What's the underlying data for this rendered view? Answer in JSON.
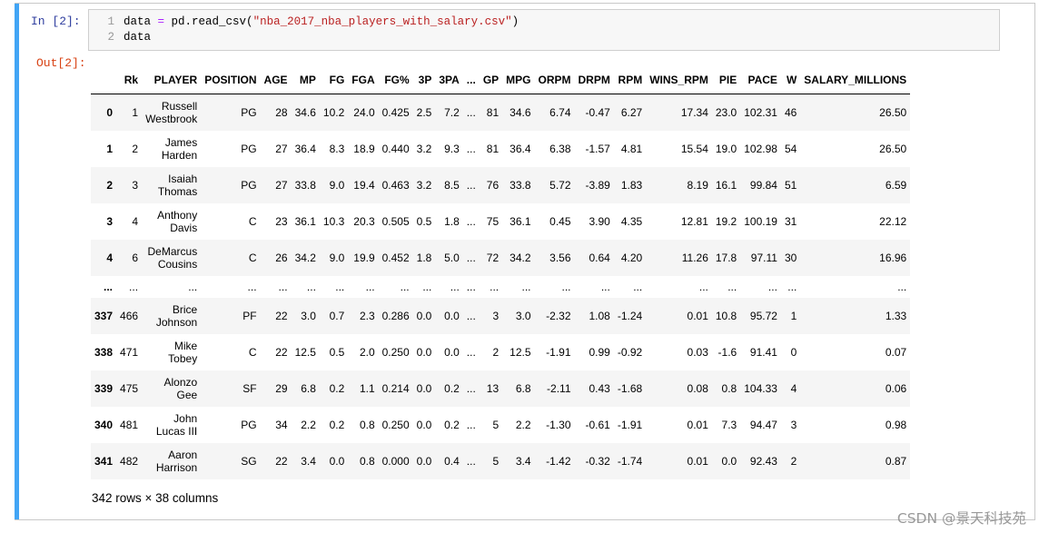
{
  "cell": {
    "in_prompt": "In  [2]:",
    "out_prompt": "Out[2]:",
    "line_numbers": [
      "1",
      "2"
    ],
    "code": {
      "line1_pre": "data ",
      "line1_op": "=",
      "line1_mid": " pd.read_csv(",
      "line1_str": "\"nba_2017_nba_players_with_salary.csv\"",
      "line1_post": ")",
      "line2": "data"
    }
  },
  "table": {
    "columns": [
      "",
      "Rk",
      "PLAYER",
      "POSITION",
      "AGE",
      "MP",
      "FG",
      "FGA",
      "FG%",
      "3P",
      "3PA",
      "...",
      "GP",
      "MPG",
      "ORPM",
      "DRPM",
      "RPM",
      "WINS_RPM",
      "PIE",
      "PACE",
      "W",
      "SALARY_MILLIONS"
    ],
    "rows": [
      [
        "0",
        "1",
        "Russell Westbrook",
        "PG",
        "28",
        "34.6",
        "10.2",
        "24.0",
        "0.425",
        "2.5",
        "7.2",
        "...",
        "81",
        "34.6",
        "6.74",
        "-0.47",
        "6.27",
        "17.34",
        "23.0",
        "102.31",
        "46",
        "26.50"
      ],
      [
        "1",
        "2",
        "James Harden",
        "PG",
        "27",
        "36.4",
        "8.3",
        "18.9",
        "0.440",
        "3.2",
        "9.3",
        "...",
        "81",
        "36.4",
        "6.38",
        "-1.57",
        "4.81",
        "15.54",
        "19.0",
        "102.98",
        "54",
        "26.50"
      ],
      [
        "2",
        "3",
        "Isaiah Thomas",
        "PG",
        "27",
        "33.8",
        "9.0",
        "19.4",
        "0.463",
        "3.2",
        "8.5",
        "...",
        "76",
        "33.8",
        "5.72",
        "-3.89",
        "1.83",
        "8.19",
        "16.1",
        "99.84",
        "51",
        "6.59"
      ],
      [
        "3",
        "4",
        "Anthony Davis",
        "C",
        "23",
        "36.1",
        "10.3",
        "20.3",
        "0.505",
        "0.5",
        "1.8",
        "...",
        "75",
        "36.1",
        "0.45",
        "3.90",
        "4.35",
        "12.81",
        "19.2",
        "100.19",
        "31",
        "22.12"
      ],
      [
        "4",
        "6",
        "DeMarcus Cousins",
        "C",
        "26",
        "34.2",
        "9.0",
        "19.9",
        "0.452",
        "1.8",
        "5.0",
        "...",
        "72",
        "34.2",
        "3.56",
        "0.64",
        "4.20",
        "11.26",
        "17.8",
        "97.11",
        "30",
        "16.96"
      ],
      [
        "...",
        "...",
        "...",
        "...",
        "...",
        "...",
        "...",
        "...",
        "...",
        "...",
        "...",
        "...",
        "...",
        "...",
        "...",
        "...",
        "...",
        "...",
        "...",
        "...",
        "...",
        "..."
      ],
      [
        "337",
        "466",
        "Brice Johnson",
        "PF",
        "22",
        "3.0",
        "0.7",
        "2.3",
        "0.286",
        "0.0",
        "0.0",
        "...",
        "3",
        "3.0",
        "-2.32",
        "1.08",
        "-1.24",
        "0.01",
        "10.8",
        "95.72",
        "1",
        "1.33"
      ],
      [
        "338",
        "471",
        "Mike Tobey",
        "C",
        "22",
        "12.5",
        "0.5",
        "2.0",
        "0.250",
        "0.0",
        "0.0",
        "...",
        "2",
        "12.5",
        "-1.91",
        "0.99",
        "-0.92",
        "0.03",
        "-1.6",
        "91.41",
        "0",
        "0.07"
      ],
      [
        "339",
        "475",
        "Alonzo Gee",
        "SF",
        "29",
        "6.8",
        "0.2",
        "1.1",
        "0.214",
        "0.0",
        "0.2",
        "...",
        "13",
        "6.8",
        "-2.11",
        "0.43",
        "-1.68",
        "0.08",
        "0.8",
        "104.33",
        "4",
        "0.06"
      ],
      [
        "340",
        "481",
        "John Lucas III",
        "PG",
        "34",
        "2.2",
        "0.2",
        "0.8",
        "0.250",
        "0.0",
        "0.2",
        "...",
        "5",
        "2.2",
        "-1.30",
        "-0.61",
        "-1.91",
        "0.01",
        "7.3",
        "94.47",
        "3",
        "0.98"
      ],
      [
        "341",
        "482",
        "Aaron Harrison",
        "SG",
        "22",
        "3.4",
        "0.0",
        "0.8",
        "0.000",
        "0.0",
        "0.4",
        "...",
        "5",
        "3.4",
        "-1.42",
        "-0.32",
        "-1.74",
        "0.01",
        "0.0",
        "92.43",
        "2",
        "0.87"
      ]
    ]
  },
  "footer": "342 rows × 38 columns",
  "watermark": "CSDN @景天科技苑",
  "colors": {
    "cell_bar": "#42a5f5",
    "in_prompt": "#303f9f",
    "out_prompt": "#d84315",
    "row_stripe": "#f5f5f5"
  }
}
